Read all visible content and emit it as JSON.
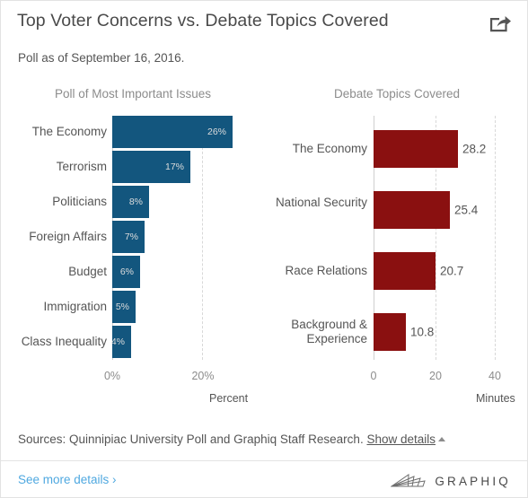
{
  "header": {
    "title": "Top Voter Concerns vs. Debate Topics Covered",
    "subtitle": "Poll as of September 16, 2016.",
    "share_icon": "share-icon"
  },
  "footer": {
    "sources_text": "Sources: Quinnipiac University Poll and Graphiq Staff Research.",
    "show_details_label": "Show details",
    "more_details_label": "See more details ›",
    "brand": "GRAPHIQ"
  },
  "colors": {
    "poll_bar": "#13567e",
    "debate_bar": "#8a1010",
    "link": "#4fa8e0",
    "label_text": "#555555",
    "muted_text": "#8c8c8c",
    "gridline": "#d8d8d8"
  },
  "chart_data": [
    {
      "type": "bar",
      "orientation": "horizontal",
      "title": "Poll of Most Important Issues",
      "xlabel": "Percent",
      "ylabel": "",
      "xlim": [
        0,
        28
      ],
      "xticks": [
        0,
        20
      ],
      "xtick_labels": [
        "0%",
        "20%"
      ],
      "grid": true,
      "legend": "none",
      "color": "#13567e",
      "value_suffix": "%",
      "categories": [
        "The Economy",
        "Terrorism",
        "Politicians",
        "Foreign Affairs",
        "Budget",
        "Immigration",
        "Class Inequality"
      ],
      "values": [
        26,
        17,
        8,
        7,
        6,
        5,
        4
      ],
      "data_labels": [
        "26%",
        "17%",
        "8%",
        "7%",
        "6%",
        "5%",
        "4%"
      ]
    },
    {
      "type": "bar",
      "orientation": "horizontal",
      "title": "Debate Topics Covered",
      "xlabel": "Minutes",
      "ylabel": "",
      "xlim": [
        0,
        45
      ],
      "xticks": [
        0,
        20,
        40
      ],
      "xtick_labels": [
        "0",
        "20",
        "40"
      ],
      "grid": true,
      "legend": "none",
      "color": "#8a1010",
      "value_suffix": "",
      "categories": [
        "The Economy",
        "National Security",
        "Race Relations",
        "Background & Experience"
      ],
      "values": [
        28.2,
        25.4,
        20.7,
        10.8
      ],
      "data_labels": [
        "28.2",
        "25.4",
        "20.7",
        "10.8"
      ]
    }
  ]
}
